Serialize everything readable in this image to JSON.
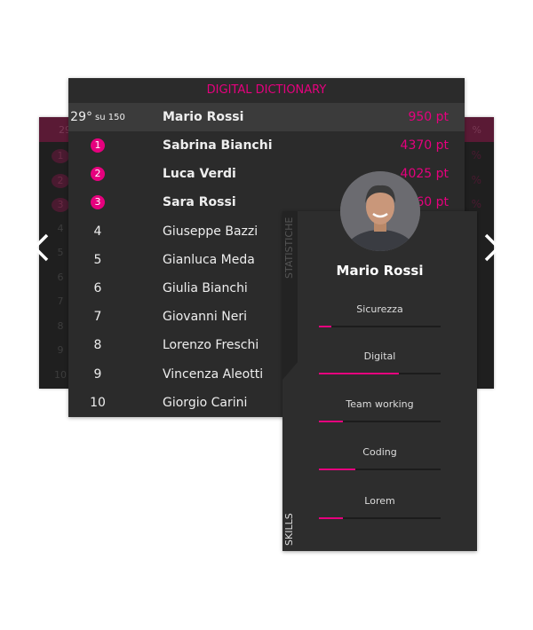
{
  "accent": "#e6007e",
  "background_card": {
    "my_rank": "29",
    "ranks": [
      "1",
      "2",
      "3",
      "4",
      "5",
      "6",
      "7",
      "8",
      "9",
      "10"
    ],
    "pct_symbol": "%"
  },
  "leaderboard": {
    "title": "DIGITAL DICTIONARY",
    "me": {
      "rank": "29°",
      "of": "su 150",
      "name": "Mario Rossi",
      "points": "950 pt"
    },
    "rows": [
      {
        "rank": "1",
        "name": "Sabrina Bianchi",
        "points": "4370 pt",
        "medal": true
      },
      {
        "rank": "2",
        "name": "Luca Verdi",
        "points": "4025 pt",
        "medal": true
      },
      {
        "rank": "3",
        "name": "Sara Rossi",
        "points": "3960 pt",
        "medal": true
      },
      {
        "rank": "4",
        "name": "Giuseppe Bazzi"
      },
      {
        "rank": "5",
        "name": "Gianluca Meda"
      },
      {
        "rank": "6",
        "name": "Giulia Bianchi"
      },
      {
        "rank": "7",
        "name": "Giovanni Neri"
      },
      {
        "rank": "8",
        "name": "Lorenzo Freschi"
      },
      {
        "rank": "9",
        "name": "Vincenza Aleotti"
      },
      {
        "rank": "10",
        "name": "Giorgio Carini"
      }
    ]
  },
  "nav": {
    "prev_icon": "chevron-left-icon",
    "next_icon": "chevron-right-icon"
  },
  "profile": {
    "name": "Mario Rossi",
    "tab_stats": "STATISTICHE",
    "tab_skills": "SKILLS",
    "skills": [
      {
        "label": "Sicurezza",
        "percent": 10
      },
      {
        "label": "Digital",
        "percent": 66
      },
      {
        "label": "Team working",
        "percent": 20
      },
      {
        "label": "Coding",
        "percent": 30
      },
      {
        "label": "Lorem",
        "percent": 20
      }
    ]
  }
}
